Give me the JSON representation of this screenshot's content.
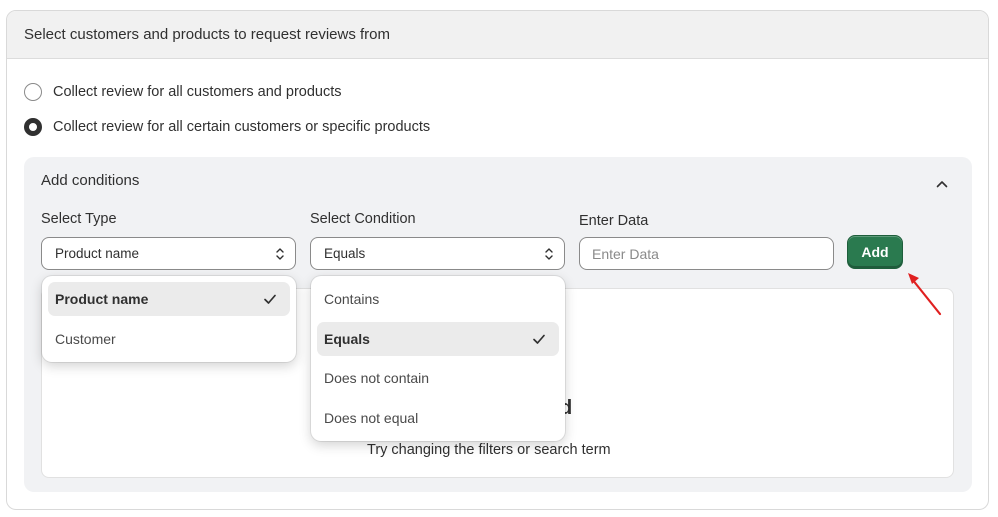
{
  "header": {
    "title": "Select customers and products to request reviews from"
  },
  "radio_options": [
    {
      "label": "Collect review for all customers and products",
      "checked": false
    },
    {
      "label": "Collect review for all certain customers or specific products",
      "checked": true
    }
  ],
  "conditions": {
    "title": "Add conditions",
    "collapse_icon": "chevron-up-icon",
    "type_label": "Select Type",
    "type_value": "Product name",
    "condition_label": "Select Condition",
    "condition_value": "Equals",
    "data_label": "Enter Data",
    "data_placeholder": "Enter Data",
    "data_value": "",
    "add_label": "Add"
  },
  "type_dropdown": {
    "options": [
      {
        "label": "Product name",
        "selected": true
      },
      {
        "label": "Customer",
        "selected": false
      }
    ]
  },
  "condition_dropdown": {
    "options": [
      {
        "label": "Contains",
        "selected": false
      },
      {
        "label": "Equals",
        "selected": true
      },
      {
        "label": "Does not contain",
        "selected": false
      },
      {
        "label": "Does not equal",
        "selected": false
      }
    ]
  },
  "empty_state": {
    "heading_fragment": "d",
    "message": "Try changing the filters or search term"
  },
  "colors": {
    "accent_button": "#2a7a4f",
    "annotation_arrow": "#e02020"
  }
}
